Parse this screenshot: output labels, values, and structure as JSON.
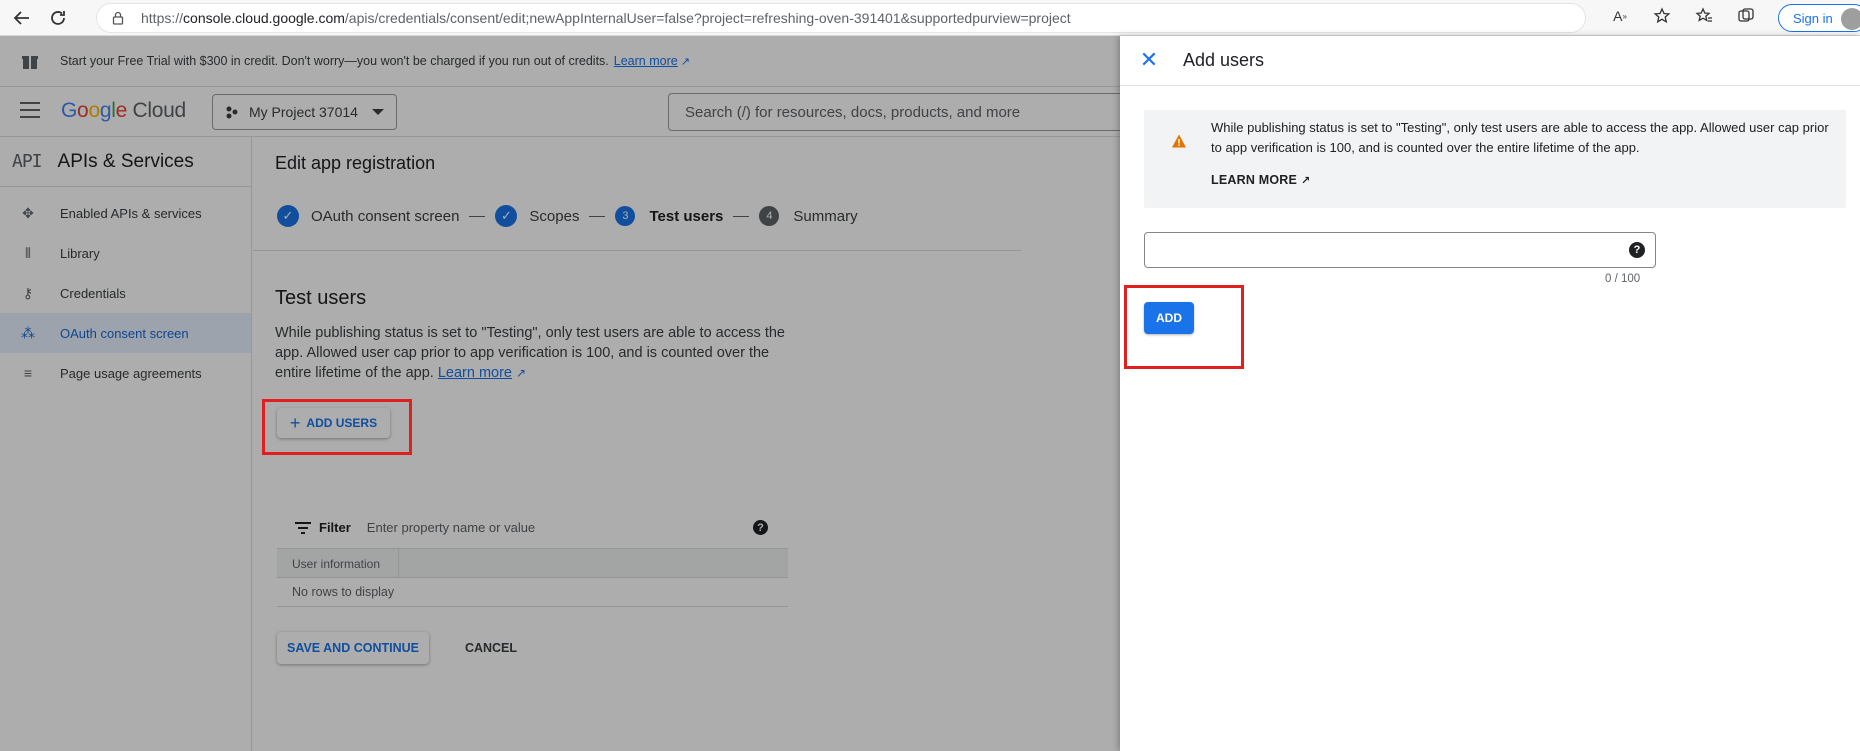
{
  "browser": {
    "url_prefix": "https://",
    "url_host": "console.cloud.google.com",
    "url_rest": "/apis/credentials/consent/edit;newAppInternalUser=false?project=refreshing-oven-391401&supportedpurview=project",
    "signin_label": "Sign in"
  },
  "trial_banner": {
    "text": "Start your Free Trial with $300 in credit. Don't worry—you won't be charged if you run out of credits.",
    "link": "Learn more"
  },
  "header": {
    "logo_google": "Google",
    "logo_cloud": "Cloud",
    "project": "My Project 37014",
    "search_placeholder": "Search (/) for resources, docs, products, and more"
  },
  "sidebar": {
    "api_glyph": "API",
    "title": "APIs & Services",
    "items": [
      {
        "label": "Enabled APIs & services",
        "icon": "diamond-icon"
      },
      {
        "label": "Library",
        "icon": "library-icon"
      },
      {
        "label": "Credentials",
        "icon": "key-icon"
      },
      {
        "label": "OAuth consent screen",
        "icon": "consent-icon",
        "active": true
      },
      {
        "label": "Page usage agreements",
        "icon": "settings-list-icon"
      }
    ]
  },
  "main": {
    "title": "Edit app registration",
    "steps": [
      {
        "label": "OAuth consent screen",
        "state": "done"
      },
      {
        "label": "Scopes",
        "state": "done"
      },
      {
        "number": "3",
        "label": "Test users",
        "state": "current"
      },
      {
        "number": "4",
        "label": "Summary",
        "state": "todo"
      }
    ],
    "section_title": "Test users",
    "description": "While publishing status is set to \"Testing\", only test users are able to access the app. Allowed user cap prior to app verification is 100, and is counted over the entire lifetime of the app.",
    "learn_more": "Learn more",
    "add_users_label": "ADD USERS",
    "filter_label": "Filter",
    "filter_placeholder": "Enter property name or value",
    "column_header": "User information",
    "empty_text": "No rows to display",
    "save_label": "SAVE AND CONTINUE",
    "cancel_label": "CANCEL"
  },
  "drawer": {
    "title": "Add users",
    "notice": "While publishing status is set to \"Testing\", only test users are able to access the app. Allowed user cap prior to app verification is 100, and is counted over the entire lifetime of the app.",
    "notice_link": "LEARN MORE",
    "input_value": "",
    "counter": "0 / 100",
    "add_label": "ADD"
  },
  "colors": {
    "accent": "#1a73e8",
    "highlight": "#e01f1f",
    "warning": "#e37400"
  }
}
